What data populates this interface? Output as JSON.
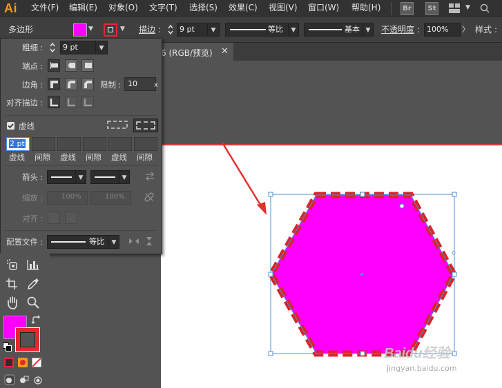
{
  "app": {
    "logo": "Ai"
  },
  "menu": [
    "文件(F)",
    "编辑(E)",
    "对象(O)",
    "文字(T)",
    "选择(S)",
    "效果(C)",
    "视图(V)",
    "窗口(W)",
    "帮助(H)"
  ],
  "menu_icons": [
    "Br",
    "St"
  ],
  "control": {
    "selection_label": "多边形",
    "fill_color": "#ff00ff",
    "stroke_color": "#e5282f",
    "stroke_label": "描边",
    "stroke_weight": "9 pt",
    "profile": "等比",
    "brush": "基本",
    "opacity_label": "不透明度",
    "opacity": "100%",
    "style_label": "样式"
  },
  "doc": {
    "tab_title": "6 (RGB/预览)"
  },
  "stroke_panel": {
    "weight_label": "粗细",
    "weight": "9 pt",
    "cap_label": "端点",
    "corner_label": "边角",
    "limit_label": "限制",
    "limit": "10",
    "limit_unit": "x",
    "align_label": "对齐描边",
    "dashed_label": "虚线",
    "dashed_checked": true,
    "dash_values": [
      "2 pt",
      "",
      "",
      "",
      "",
      ""
    ],
    "dash_labels": [
      "虚线",
      "间隙",
      "虚线",
      "间隙",
      "虚线",
      "间隙"
    ],
    "arrow_label": "箭头",
    "scale_label": "缩放",
    "scale1": "100%",
    "scale2": "100%",
    "align2_label": "对齐",
    "profile_label": "配置文件",
    "profile_value": "等比"
  },
  "toolbox": {
    "fill_color": "#ff00ff",
    "stroke_color": "#e5282f"
  },
  "watermark": {
    "brand": "Baidu经验",
    "url": "jingyan.baidu.com"
  },
  "shape": {
    "fill": "#ff00ff",
    "stroke": "#d9252d"
  },
  "accent": {
    "arrow": "#e0322d",
    "selection": "#4a90d9"
  }
}
